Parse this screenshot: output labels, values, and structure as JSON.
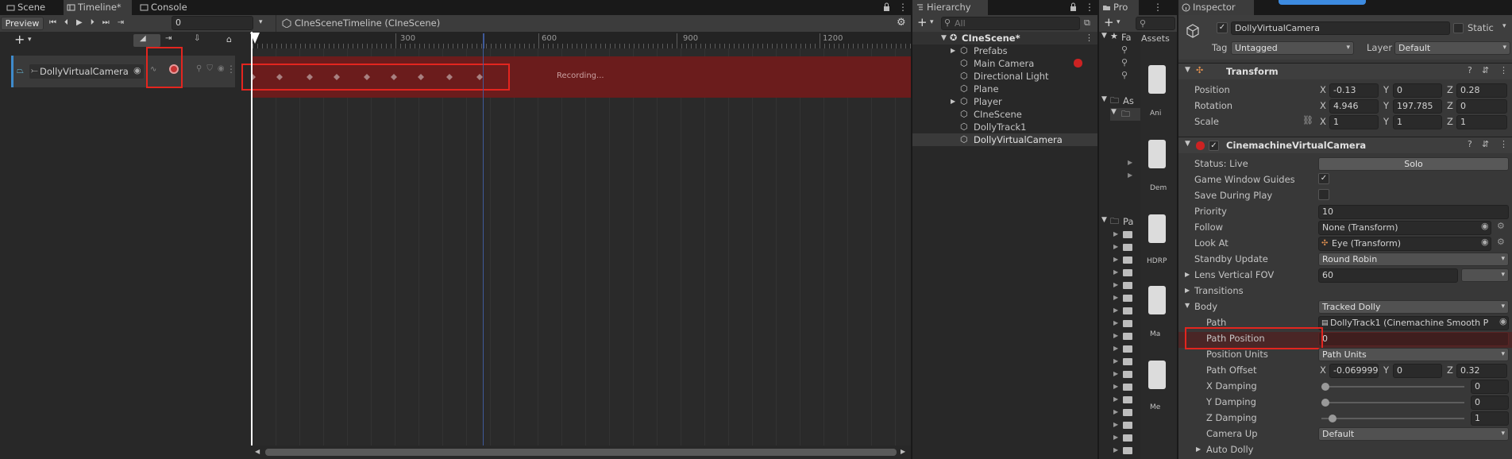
{
  "timeline": {
    "tabs": [
      {
        "label": "Scene"
      },
      {
        "label": "Timeline*"
      },
      {
        "label": "Console"
      }
    ],
    "preview_label": "Preview",
    "frame_value": "0",
    "asset_name": "CIneSceneTimeline (CIneScene)",
    "ruler_labels": [
      "300",
      "600",
      "900",
      "1200"
    ],
    "track_name": "DollyVirtualCamera",
    "recording_label": "Recording..."
  },
  "hierarchy": {
    "title": "Hierarchy",
    "search_placeholder": "All",
    "scene_name": "CIneScene*",
    "items": [
      "Prefabs",
      "Main Camera",
      "Directional Light",
      "Plane",
      "Player",
      "CIneScene",
      "DollyTrack1",
      "DollyVirtualCamera"
    ]
  },
  "project": {
    "title": "Pro",
    "fav_label": "Fa",
    "assets_header": "Assets",
    "assets_short": "As",
    "packages_short": "Pa",
    "thumb_labels": [
      "Ani",
      "Dem",
      "HDRP",
      "Ma",
      "Me"
    ]
  },
  "inspector": {
    "title": "Inspector",
    "object_name": "DollyVirtualCamera",
    "static_label": "Static",
    "tag_label": "Tag",
    "tag_value": "Untagged",
    "layer_label": "Layer",
    "layer_value": "Default",
    "transform": {
      "title": "Transform",
      "position_label": "Position",
      "position": {
        "x": "-0.13",
        "y": "0",
        "z": "0.28"
      },
      "rotation_label": "Rotation",
      "rotation": {
        "x": "4.946",
        "y": "197.785",
        "z": "0"
      },
      "scale_label": "Scale",
      "scale": {
        "x": "1",
        "y": "1",
        "z": "1"
      }
    },
    "axis": {
      "x": "X",
      "y": "Y",
      "z": "Z"
    },
    "vcam": {
      "title": "CinemachineVirtualCamera",
      "status_label": "Status: Live",
      "solo_label": "Solo",
      "game_window_guides": "Game Window Guides",
      "save_during_play": "Save During Play",
      "priority_label": "Priority",
      "priority_value": "10",
      "follow_label": "Follow",
      "follow_value": "None (Transform)",
      "lookat_label": "Look At",
      "lookat_value": "Eye (Transform)",
      "standby_label": "Standby Update",
      "standby_value": "Round Robin",
      "fov_label": "Lens Vertical FOV",
      "fov_value": "60",
      "transitions_label": "Transitions",
      "body_label": "Body",
      "body_value": "Tracked Dolly",
      "path_label": "Path",
      "path_value": "DollyTrack1 (Cinemachine Smooth P",
      "path_position_label": "Path Position",
      "path_position_value": "0",
      "position_units_label": "Position Units",
      "position_units_value": "Path Units",
      "path_offset_label": "Path Offset",
      "path_offset": {
        "x": "-0.069999",
        "y": "0",
        "z": "0.32"
      },
      "x_damping_label": "X Damping",
      "x_damping": "0",
      "x_damping_level": 0,
      "y_damping_label": "Y Damping",
      "y_damping": "0",
      "y_damping_level": 0,
      "z_damping_label": "Z Damping",
      "z_damping": "1",
      "z_damping_level": 0.05,
      "camera_up_label": "Camera Up",
      "camera_up_value": "Default",
      "auto_dolly_label": "Auto Dolly"
    }
  }
}
